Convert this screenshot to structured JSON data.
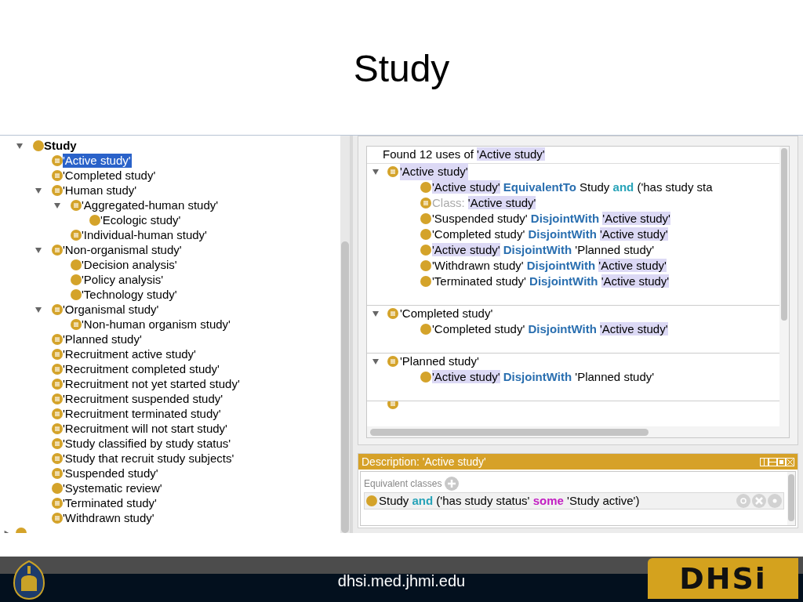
{
  "slide_title": "Study",
  "class_tree": {
    "items": [
      {
        "label": "Study",
        "kind": "primitive",
        "bold": true,
        "selected": false,
        "expanded": true,
        "children": [
          {
            "label": "'Active study'",
            "kind": "defined",
            "selected": true
          },
          {
            "label": "'Completed study'",
            "kind": "defined",
            "selected": false
          },
          {
            "label": "'Human study'",
            "kind": "defined",
            "selected": false,
            "expanded": true,
            "children": [
              {
                "label": "'Aggregated-human study'",
                "kind": "defined",
                "selected": false,
                "expanded": true,
                "children": [
                  {
                    "label": "'Ecologic study'",
                    "kind": "primitive",
                    "selected": false
                  }
                ]
              },
              {
                "label": "'Individual-human study'",
                "kind": "defined",
                "selected": false
              }
            ]
          },
          {
            "label": "'Non-organismal study'",
            "kind": "defined",
            "selected": false,
            "expanded": true,
            "children": [
              {
                "label": "'Decision analysis'",
                "kind": "primitive",
                "selected": false
              },
              {
                "label": "'Policy analysis'",
                "kind": "primitive",
                "selected": false
              },
              {
                "label": "'Technology study'",
                "kind": "primitive",
                "selected": false
              }
            ]
          },
          {
            "label": "'Organismal study'",
            "kind": "defined",
            "selected": false,
            "expanded": true,
            "children": [
              {
                "label": "'Non-human organism study'",
                "kind": "defined",
                "selected": false
              }
            ]
          },
          {
            "label": "'Planned study'",
            "kind": "defined",
            "selected": false
          },
          {
            "label": "'Recruitment active study'",
            "kind": "defined",
            "selected": false
          },
          {
            "label": "'Recruitment completed study'",
            "kind": "defined",
            "selected": false
          },
          {
            "label": "'Recruitment not yet started study'",
            "kind": "defined",
            "selected": false
          },
          {
            "label": "'Recruitment suspended study'",
            "kind": "defined",
            "selected": false
          },
          {
            "label": "'Recruitment terminated study'",
            "kind": "defined",
            "selected": false
          },
          {
            "label": "'Recruitment will not start study'",
            "kind": "defined",
            "selected": false
          },
          {
            "label": "'Study classified by study status'",
            "kind": "defined",
            "selected": false
          },
          {
            "label": "'Study that recruit study subjects'",
            "kind": "defined",
            "selected": false
          },
          {
            "label": "'Suspended study'",
            "kind": "defined",
            "selected": false
          },
          {
            "label": "'Systematic review'",
            "kind": "primitive",
            "selected": false
          },
          {
            "label": "'Terminated study'",
            "kind": "defined",
            "selected": false
          },
          {
            "label": "'Withdrawn study'",
            "kind": "defined",
            "selected": false
          }
        ]
      }
    ]
  },
  "usage": {
    "header": [
      {
        "text": "Found 12 uses of ",
        "kind": "plain"
      },
      {
        "text": "'Active study'",
        "kind": "highlight"
      }
    ],
    "groups": [
      {
        "title": "'Active study'",
        "highlighted": true,
        "kind": "defined",
        "expanded": true,
        "items": [
          {
            "kind": "primitive",
            "segments": [
              {
                "text": "'Active study'",
                "kind": "highlight"
              },
              {
                "text": " EquivalentTo",
                "kind": "keyword"
              },
              {
                "text": " Study ",
                "kind": "plain"
              },
              {
                "text": "and",
                "kind": "keyword-light"
              },
              {
                "text": " ('has study sta",
                "kind": "plain"
              }
            ]
          },
          {
            "kind": "defined",
            "segments": [
              {
                "text": "Class: ",
                "kind": "label"
              },
              {
                "text": "'Active study'",
                "kind": "highlight"
              }
            ]
          },
          {
            "kind": "primitive",
            "segments": [
              {
                "text": "'Suspended study'",
                "kind": "plain"
              },
              {
                "text": " DisjointWith ",
                "kind": "keyword"
              },
              {
                "text": "'Active study'",
                "kind": "highlight"
              }
            ]
          },
          {
            "kind": "primitive",
            "segments": [
              {
                "text": "'Completed study'",
                "kind": "plain"
              },
              {
                "text": " DisjointWith ",
                "kind": "keyword"
              },
              {
                "text": "'Active study'",
                "kind": "highlight"
              }
            ]
          },
          {
            "kind": "primitive",
            "segments": [
              {
                "text": "'Active study'",
                "kind": "highlight"
              },
              {
                "text": " DisjointWith ",
                "kind": "keyword"
              },
              {
                "text": "'Planned study'",
                "kind": "plain"
              }
            ]
          },
          {
            "kind": "primitive",
            "segments": [
              {
                "text": "'Withdrawn study'",
                "kind": "plain"
              },
              {
                "text": " DisjointWith ",
                "kind": "keyword"
              },
              {
                "text": "'Active study'",
                "kind": "highlight"
              }
            ]
          },
          {
            "kind": "primitive",
            "segments": [
              {
                "text": "'Terminated study'",
                "kind": "plain"
              },
              {
                "text": " DisjointWith ",
                "kind": "keyword"
              },
              {
                "text": "'Active study'",
                "kind": "highlight"
              }
            ]
          }
        ]
      },
      {
        "title": "'Completed study'",
        "highlighted": false,
        "kind": "defined",
        "expanded": true,
        "items": [
          {
            "kind": "primitive",
            "segments": [
              {
                "text": "'Completed study'",
                "kind": "plain"
              },
              {
                "text": " DisjointWith ",
                "kind": "keyword"
              },
              {
                "text": "'Active study'",
                "kind": "highlight"
              }
            ]
          }
        ]
      },
      {
        "title": "'Planned study'",
        "highlighted": false,
        "kind": "defined",
        "expanded": true,
        "items": [
          {
            "kind": "primitive",
            "segments": [
              {
                "text": "'Active study'",
                "kind": "highlight"
              },
              {
                "text": " DisjointWith ",
                "kind": "keyword"
              },
              {
                "text": "'Planned study'",
                "kind": "plain"
              }
            ]
          }
        ]
      }
    ]
  },
  "description": {
    "title": "Description: 'Active study'",
    "section": "Equivalent classes",
    "expression": [
      {
        "text": "Study ",
        "kind": "plain"
      },
      {
        "text": "and",
        "kind": "keyword-light"
      },
      {
        "text": " ('has study status' ",
        "kind": "plain"
      },
      {
        "text": "some",
        "kind": "keyword-magenta"
      },
      {
        "text": " 'Study active')",
        "kind": "plain"
      }
    ]
  },
  "footer": {
    "url": "dhsi.med.jhmi.edu",
    "logo": "DHSi"
  }
}
